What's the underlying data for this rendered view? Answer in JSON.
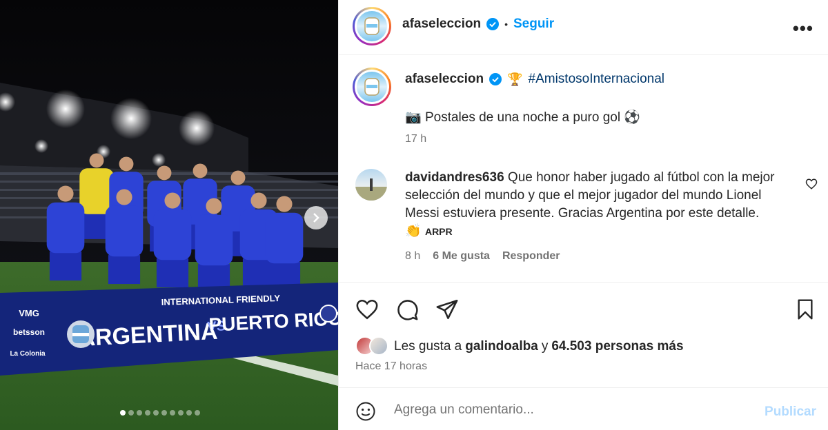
{
  "post": {
    "account": "afaseleccion",
    "follow_label": "Seguir",
    "more_label": "•••",
    "separator": "•",
    "caption": {
      "trophy_emoji": "🏆",
      "hashtag": "#AmistosoInternacional",
      "camera_emoji": "📷",
      "text": "Postales de una noche a puro gol",
      "ball_emoji": "⚽",
      "time": "17 h"
    },
    "comment": {
      "user": "davidandres636",
      "text": "Que honor haber jugado al fútbol con la mejor selección del mundo y que el mejor jugador del mundo Lionel Messi estuviera presente. Gracias Argentina por este detalle.",
      "emoji": "👏",
      "tag": "ARPR",
      "time": "8 h",
      "likes": "6 Me gusta",
      "reply_label": "Responder"
    },
    "likes": {
      "prefix": "Les gusta a ",
      "user": "galindoalba",
      "connector": " y ",
      "count": "64.503 personas más"
    },
    "posted_ago": "Hace 17 horas",
    "add_comment": {
      "placeholder": "Agrega un comentario...",
      "publish_label": "Publicar"
    }
  },
  "photo": {
    "banner_top": "INTERNATIONAL FRIENDLY",
    "team_home": "ARGENTINA",
    "vs": "VS",
    "team_away": "PUERTO RICO",
    "sponsors": [
      "VMG",
      "betsson",
      "La Colonia"
    ],
    "slide_count": 10,
    "current_slide": 1
  },
  "colors": {
    "accent": "#0095f6",
    "hashtag": "#00376b",
    "publish_disabled": "#b3dbff",
    "jersey": "#2d43d6",
    "banner": "#14257a"
  },
  "icons": [
    "verified-icon",
    "more-icon",
    "heart-icon",
    "comment-icon",
    "share-icon",
    "bookmark-icon",
    "emoji-icon",
    "next-icon"
  ]
}
